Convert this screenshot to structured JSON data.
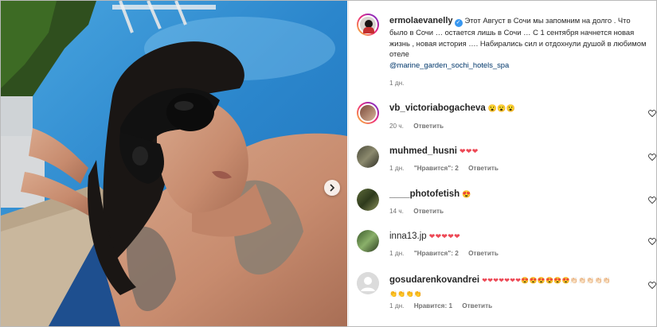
{
  "post": {
    "author": "ermolaevanelly",
    "caption": "Этот Август в Сочи мы запомним на долго . Что было в Сочи … остается лишь в Сочи … С 1 сентября начнется новая жизнь , новая история …. Набирались сил и отдохнули душой в любимом отеле",
    "mention": "@marine_garden_sochi_hotels_spa",
    "time": "1 дн."
  },
  "comments": [
    {
      "user": "vb_victoriabogacheva",
      "text": "😮😮😮",
      "time": "20 ч.",
      "likes": "",
      "reply": "Ответить"
    },
    {
      "user": "muhmed_husni",
      "text": "❤❤❤",
      "time": "1 дн.",
      "likes": "\"Нравится\": 2",
      "reply": "Ответить"
    },
    {
      "user": "____photofetish",
      "text": "😍",
      "time": "14 ч.",
      "likes": "",
      "reply": "Ответить"
    },
    {
      "user": "inna13.jp",
      "text": "❤❤❤❤❤",
      "time": "1 дн.",
      "likes": "\"Нравится\": 2",
      "reply": "Ответить"
    },
    {
      "user": "gosudarenkovandrei",
      "text": "❤❤❤❤❤❤❤😍😍😍😍😍😍👏🏻👏🏻👏🏻👏🏻👏🏻",
      "text2": "👏👏👏👏",
      "time": "1 дн.",
      "likes": "Нравится: 1",
      "reply": "Ответить"
    }
  ],
  "colors": {
    "accent": "#3897f0",
    "heart_red": "#ed4956",
    "text": "#262626",
    "muted": "#737373"
  }
}
